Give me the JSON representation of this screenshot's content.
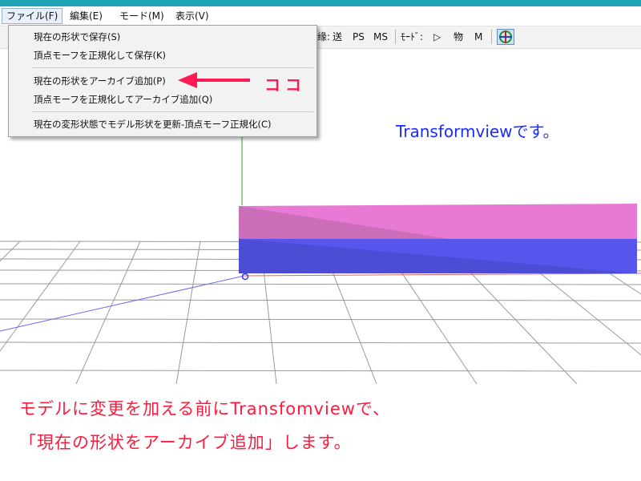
{
  "menubar": {
    "items": [
      "ファイル(F)",
      "編集(E)",
      "モード(M)",
      "表示(V)"
    ]
  },
  "toolbar": {
    "items": [
      "缘:",
      "送",
      "PS",
      "MS",
      "ﾓｰﾄﾞ:",
      "▷",
      "物",
      "M"
    ],
    "target_icon": "target-icon"
  },
  "file_menu": {
    "items": [
      "現在の形状で保存(S)",
      "頂点モーフを正規化して保存(K)",
      "現在の形状をアーカイブ追加(P)",
      "頂点モーフを正規化してアーカイブ追加(Q)",
      "現在の変形状態でモデル形状を更新-頂点モーフ正規化(C)"
    ],
    "highlighted_index": 2
  },
  "annotations": {
    "arrow_label": "ココ",
    "transformview_note": "Transformviewです。",
    "instruction_line1": "モデルに変更を加える前にTransfomviewで、",
    "instruction_line2": "「現在の形状をアーカイブ追加」します。"
  },
  "colors": {
    "title_strip": "#1ca3b4",
    "annotation_red": "#ff1a3c",
    "annotation_blue": "#1a2bff",
    "box_top": "#e879d4",
    "box_bottom": "#5656ec"
  }
}
